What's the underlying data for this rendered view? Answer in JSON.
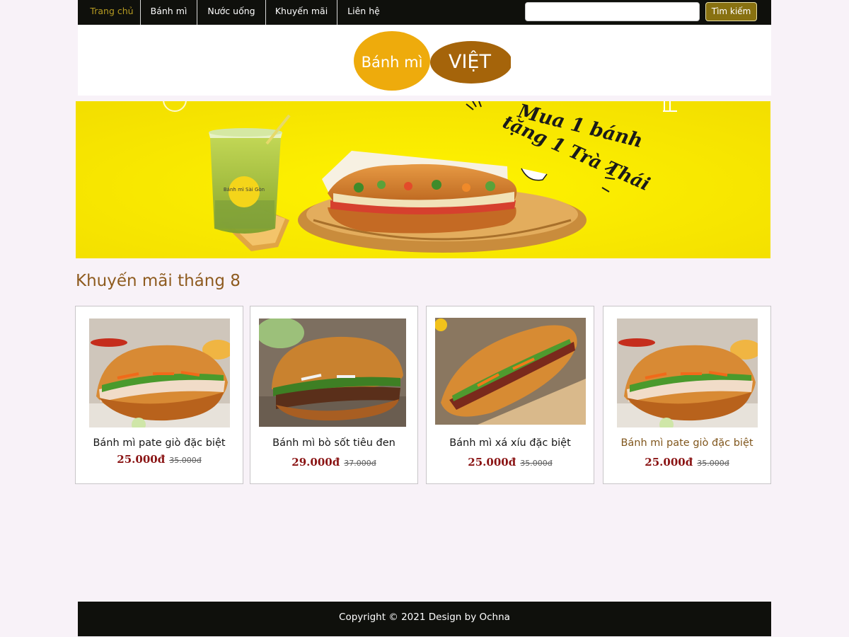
{
  "nav": {
    "items": [
      {
        "label": "Trang chủ",
        "active": true
      },
      {
        "label": "Bánh mì",
        "active": false
      },
      {
        "label": "Nước uống",
        "active": false
      },
      {
        "label": "Khuyến mãi",
        "active": false
      },
      {
        "label": "Liên hệ",
        "active": false
      }
    ],
    "search": {
      "placeholder": "",
      "value": "",
      "button_label": "Tìm kiếm"
    },
    "colors": {
      "bar": "#0f100c",
      "active": "#b69b22",
      "search_button": "#887111"
    }
  },
  "logo": {
    "part1": "Bánh mì",
    "part2": "VIỆT",
    "color1": "#eeab0c",
    "color2": "#a5640a"
  },
  "banner": {
    "headline_line1": "Mua 1 bánh",
    "headline_line2": "tặng 1 Trà Thái",
    "cup_text": "Bánh mì Sài Gòn",
    "background": "#fff200"
  },
  "section": {
    "title": "Khuyến mãi tháng 8",
    "color": "#8e5b1f"
  },
  "products": [
    {
      "name": "Bánh mì pate giò đặc biệt",
      "price": "25.000đ",
      "old_price": "35.000đ",
      "image_icon": "banh-mi-pate-photo"
    },
    {
      "name": "Bánh mì bò sốt tiêu đen",
      "price": "29.000đ",
      "old_price": "37.000đ",
      "image_icon": "banh-mi-bo-photo"
    },
    {
      "name": "Bánh mì xá xíu đặc biệt",
      "price": "25.000đ",
      "old_price": "35.000đ",
      "image_icon": "banh-mi-xa-xiu-photo"
    },
    {
      "name": "Bánh mì pate giò đặc biệt",
      "price": "25.000đ",
      "old_price": "35.000đ",
      "image_icon": "banh-mi-pate-photo"
    }
  ],
  "footer": {
    "text": "Copyright © 2021 Design by Ochna",
    "background": "#0f100c"
  }
}
